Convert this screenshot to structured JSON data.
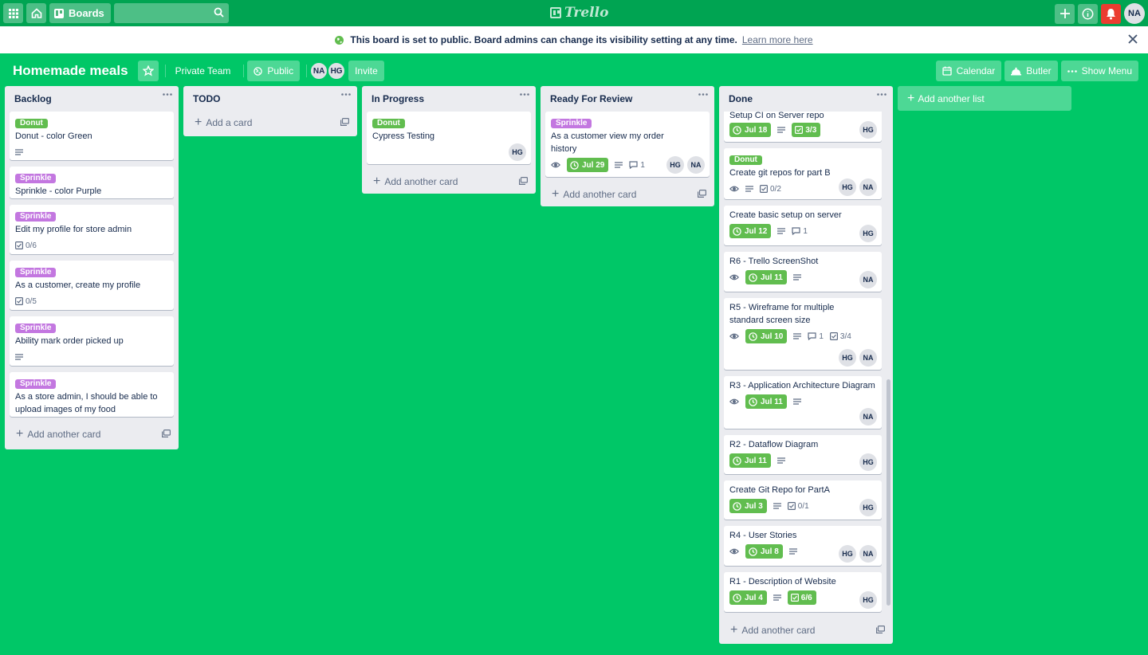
{
  "header": {
    "boards_label": "Boards",
    "logo_text": "Trello",
    "user_initials": "NA"
  },
  "banner": {
    "message": "This board is set to public. Board admins can change its visibility setting at any time.",
    "link": "Learn more here"
  },
  "board": {
    "title": "Homemade meals",
    "team": "Private Team",
    "visibility": "Public",
    "members": [
      "NA",
      "HG"
    ],
    "invite": "Invite",
    "calendar": "Calendar",
    "butler": "Butler",
    "show_menu": "Show Menu"
  },
  "colors": {
    "board_bg": "#00c767",
    "header_bg": "#00a452",
    "label_green": "#61bd4f",
    "label_purple": "#c377e0",
    "due_green": "#61bd4f",
    "bell_red": "#eb3c30"
  },
  "lists": {
    "backlog": {
      "title": "Backlog",
      "add": "Add another card",
      "cards": [
        {
          "label": "Donut",
          "title": "Donut - color Green"
        },
        {
          "label": "Sprinkle",
          "title": "Sprinkle - color Purple"
        },
        {
          "label": "Sprinkle",
          "title": "Edit my profile for store admin",
          "checklist": "0/6"
        },
        {
          "label": "Sprinkle",
          "title": "As a customer, create my profile",
          "checklist": "0/5"
        },
        {
          "label": "Sprinkle",
          "title": "Ability mark order picked up"
        },
        {
          "label": "Sprinkle",
          "title": "As a store admin, I should be able to upload images of my food"
        }
      ]
    },
    "todo": {
      "title": "TODO",
      "add": "Add a card"
    },
    "inprogress": {
      "title": "In Progress",
      "add": "Add another card",
      "cards": [
        {
          "label": "Donut",
          "title": "Cypress Testing",
          "members": [
            "HG"
          ]
        }
      ]
    },
    "review": {
      "title": "Ready For Review",
      "add": "Add another card",
      "cards": [
        {
          "label": "Sprinkle",
          "title": "As a customer view my order history",
          "due": "Jul 29",
          "comments": "1",
          "members": [
            "HG",
            "NA"
          ]
        }
      ]
    },
    "done": {
      "title": "Done",
      "add": "Add another card",
      "cards": [
        {
          "title": "Setup CI on Server repo",
          "due": "Jul 18",
          "checklist": "3/3",
          "members": [
            "HG"
          ]
        },
        {
          "label": "Donut",
          "title": "Create git repos for part B",
          "checklist": "0/2",
          "members": [
            "HG",
            "NA"
          ]
        },
        {
          "title": "Create basic setup on server",
          "due": "Jul 12",
          "comments": "1",
          "members": [
            "HG"
          ]
        },
        {
          "title": "R6 - Trello ScreenShot",
          "due": "Jul 11",
          "members": [
            "NA"
          ]
        },
        {
          "title": "R5 - Wireframe for multiple standard screen size",
          "due": "Jul 10",
          "comments": "1",
          "checklist": "3/4",
          "members": [
            "HG",
            "NA"
          ]
        },
        {
          "title": "R3 - Application Architecture Diagram",
          "due": "Jul 11",
          "members": [
            "NA"
          ]
        },
        {
          "title": "R2 - Dataflow Diagram",
          "due": "Jul 11",
          "members": [
            "HG"
          ]
        },
        {
          "title": "Create Git Repo for PartA",
          "due": "Jul 3",
          "checklist": "0/1",
          "members": [
            "HG"
          ]
        },
        {
          "title": "R4 - User Stories",
          "due": "Jul 8",
          "members": [
            "HG",
            "NA"
          ]
        },
        {
          "title": "R1 - Description of Website",
          "due": "Jul 4",
          "checklist": "6/6",
          "members": [
            "HG"
          ]
        }
      ]
    }
  },
  "add_list": "Add another list"
}
